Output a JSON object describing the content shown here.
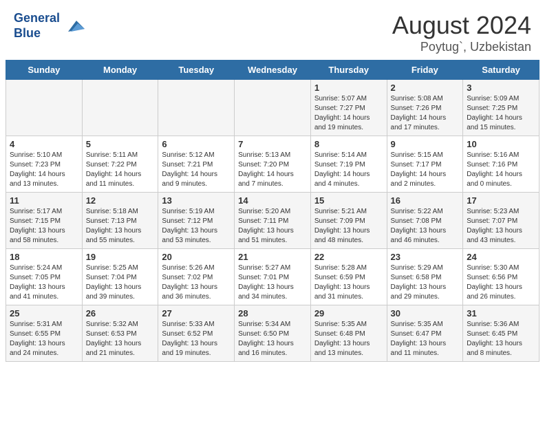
{
  "header": {
    "logo_line1": "General",
    "logo_line2": "Blue",
    "title": "August 2024",
    "subtitle": "Poytug`, Uzbekistan"
  },
  "weekdays": [
    "Sunday",
    "Monday",
    "Tuesday",
    "Wednesday",
    "Thursday",
    "Friday",
    "Saturday"
  ],
  "weeks": [
    [
      {
        "day": "",
        "info": ""
      },
      {
        "day": "",
        "info": ""
      },
      {
        "day": "",
        "info": ""
      },
      {
        "day": "",
        "info": ""
      },
      {
        "day": "1",
        "info": "Sunrise: 5:07 AM\nSunset: 7:27 PM\nDaylight: 14 hours\nand 19 minutes."
      },
      {
        "day": "2",
        "info": "Sunrise: 5:08 AM\nSunset: 7:26 PM\nDaylight: 14 hours\nand 17 minutes."
      },
      {
        "day": "3",
        "info": "Sunrise: 5:09 AM\nSunset: 7:25 PM\nDaylight: 14 hours\nand 15 minutes."
      }
    ],
    [
      {
        "day": "4",
        "info": "Sunrise: 5:10 AM\nSunset: 7:23 PM\nDaylight: 14 hours\nand 13 minutes."
      },
      {
        "day": "5",
        "info": "Sunrise: 5:11 AM\nSunset: 7:22 PM\nDaylight: 14 hours\nand 11 minutes."
      },
      {
        "day": "6",
        "info": "Sunrise: 5:12 AM\nSunset: 7:21 PM\nDaylight: 14 hours\nand 9 minutes."
      },
      {
        "day": "7",
        "info": "Sunrise: 5:13 AM\nSunset: 7:20 PM\nDaylight: 14 hours\nand 7 minutes."
      },
      {
        "day": "8",
        "info": "Sunrise: 5:14 AM\nSunset: 7:19 PM\nDaylight: 14 hours\nand 4 minutes."
      },
      {
        "day": "9",
        "info": "Sunrise: 5:15 AM\nSunset: 7:17 PM\nDaylight: 14 hours\nand 2 minutes."
      },
      {
        "day": "10",
        "info": "Sunrise: 5:16 AM\nSunset: 7:16 PM\nDaylight: 14 hours\nand 0 minutes."
      }
    ],
    [
      {
        "day": "11",
        "info": "Sunrise: 5:17 AM\nSunset: 7:15 PM\nDaylight: 13 hours\nand 58 minutes."
      },
      {
        "day": "12",
        "info": "Sunrise: 5:18 AM\nSunset: 7:13 PM\nDaylight: 13 hours\nand 55 minutes."
      },
      {
        "day": "13",
        "info": "Sunrise: 5:19 AM\nSunset: 7:12 PM\nDaylight: 13 hours\nand 53 minutes."
      },
      {
        "day": "14",
        "info": "Sunrise: 5:20 AM\nSunset: 7:11 PM\nDaylight: 13 hours\nand 51 minutes."
      },
      {
        "day": "15",
        "info": "Sunrise: 5:21 AM\nSunset: 7:09 PM\nDaylight: 13 hours\nand 48 minutes."
      },
      {
        "day": "16",
        "info": "Sunrise: 5:22 AM\nSunset: 7:08 PM\nDaylight: 13 hours\nand 46 minutes."
      },
      {
        "day": "17",
        "info": "Sunrise: 5:23 AM\nSunset: 7:07 PM\nDaylight: 13 hours\nand 43 minutes."
      }
    ],
    [
      {
        "day": "18",
        "info": "Sunrise: 5:24 AM\nSunset: 7:05 PM\nDaylight: 13 hours\nand 41 minutes."
      },
      {
        "day": "19",
        "info": "Sunrise: 5:25 AM\nSunset: 7:04 PM\nDaylight: 13 hours\nand 39 minutes."
      },
      {
        "day": "20",
        "info": "Sunrise: 5:26 AM\nSunset: 7:02 PM\nDaylight: 13 hours\nand 36 minutes."
      },
      {
        "day": "21",
        "info": "Sunrise: 5:27 AM\nSunset: 7:01 PM\nDaylight: 13 hours\nand 34 minutes."
      },
      {
        "day": "22",
        "info": "Sunrise: 5:28 AM\nSunset: 6:59 PM\nDaylight: 13 hours\nand 31 minutes."
      },
      {
        "day": "23",
        "info": "Sunrise: 5:29 AM\nSunset: 6:58 PM\nDaylight: 13 hours\nand 29 minutes."
      },
      {
        "day": "24",
        "info": "Sunrise: 5:30 AM\nSunset: 6:56 PM\nDaylight: 13 hours\nand 26 minutes."
      }
    ],
    [
      {
        "day": "25",
        "info": "Sunrise: 5:31 AM\nSunset: 6:55 PM\nDaylight: 13 hours\nand 24 minutes."
      },
      {
        "day": "26",
        "info": "Sunrise: 5:32 AM\nSunset: 6:53 PM\nDaylight: 13 hours\nand 21 minutes."
      },
      {
        "day": "27",
        "info": "Sunrise: 5:33 AM\nSunset: 6:52 PM\nDaylight: 13 hours\nand 19 minutes."
      },
      {
        "day": "28",
        "info": "Sunrise: 5:34 AM\nSunset: 6:50 PM\nDaylight: 13 hours\nand 16 minutes."
      },
      {
        "day": "29",
        "info": "Sunrise: 5:35 AM\nSunset: 6:48 PM\nDaylight: 13 hours\nand 13 minutes."
      },
      {
        "day": "30",
        "info": "Sunrise: 5:35 AM\nSunset: 6:47 PM\nDaylight: 13 hours\nand 11 minutes."
      },
      {
        "day": "31",
        "info": "Sunrise: 5:36 AM\nSunset: 6:45 PM\nDaylight: 13 hours\nand 8 minutes."
      }
    ]
  ]
}
